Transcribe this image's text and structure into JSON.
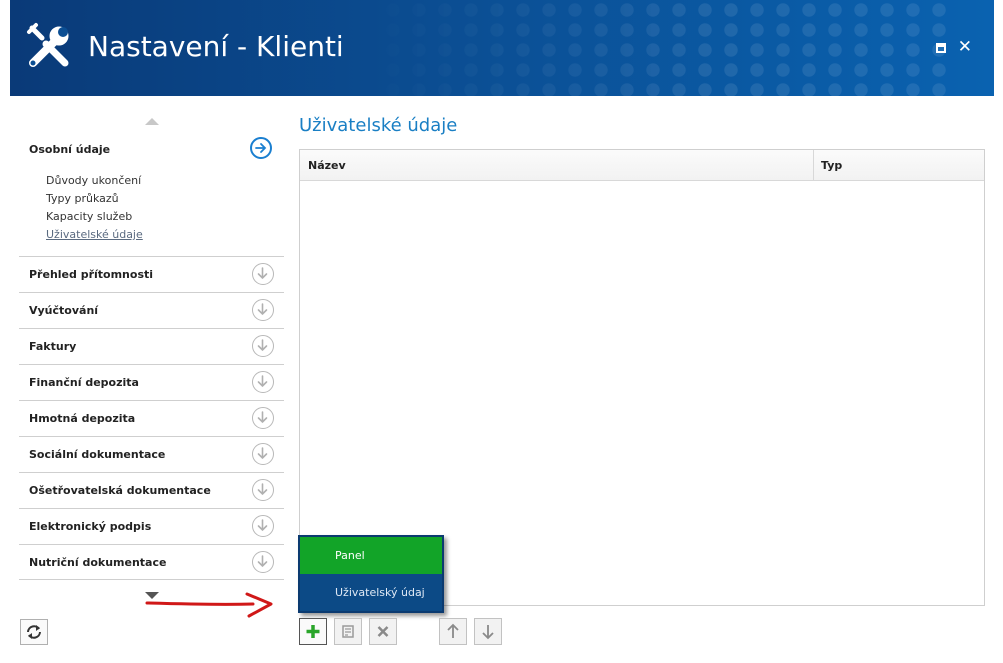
{
  "window": {
    "title": "Nastavení - Klienti"
  },
  "sidebar": {
    "expanded_section": {
      "label": "Osobní údaje",
      "items": [
        "Důvody ukončení",
        "Typy průkazů",
        "Kapacity služeb",
        "Uživatelské údaje"
      ],
      "selected_item": "Uživatelské údaje"
    },
    "sections": [
      "Přehled přítomnosti",
      "Vyúčtování",
      "Faktury",
      "Finanční depozita",
      "Hmotná depozita",
      "Sociální dokumentace",
      "Ošetřovatelská dokumentace",
      "Elektronický podpis",
      "Nutriční dokumentace"
    ]
  },
  "main": {
    "title": "Uživatelské údaje",
    "columns": [
      "Název",
      "Typ"
    ],
    "rows": []
  },
  "add_menu": {
    "items": [
      "Panel",
      "Uživatelský údaj"
    ],
    "highlighted": "Panel"
  },
  "colors": {
    "accent": "#1a7fc4",
    "header_bg": "#0b4e93",
    "menu_highlight": "#12a428",
    "menu_bg": "#0c4a86",
    "annotation_arrow": "#d01818"
  },
  "icons": {
    "app": "wrench-screwdriver-icon",
    "expanded": "arrow-right-circle-icon",
    "collapsed": "arrow-down-circle-icon",
    "toolbar": [
      "add-icon",
      "edit-icon",
      "delete-icon",
      "move-up-icon",
      "move-down-icon"
    ],
    "refresh": "refresh-icon"
  }
}
